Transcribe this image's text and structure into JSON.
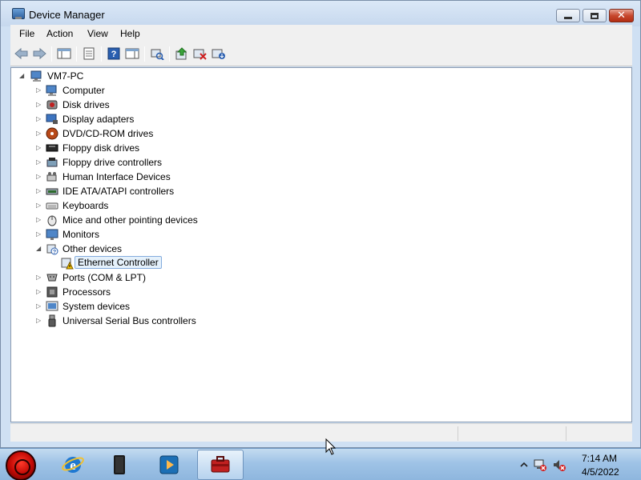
{
  "window": {
    "title": "Device Manager"
  },
  "menu": [
    "File",
    "Action",
    "View",
    "Help"
  ],
  "toolbar": {
    "buttons": [
      "back-arrow-icon",
      "forward-arrow-icon",
      "show-hide-console-tree-icon",
      "properties-icon",
      "help-icon",
      "action-pane-icon",
      "scan-hardware-icon",
      "update-driver-icon",
      "disable-icon",
      "uninstall-icon"
    ]
  },
  "tree": {
    "root": "VM7-PC",
    "categories": [
      {
        "label": "Computer",
        "icon": "computer-icon",
        "expanded": false
      },
      {
        "label": "Disk drives",
        "icon": "disk-drive-icon",
        "expanded": false
      },
      {
        "label": "Display adapters",
        "icon": "display-adapter-icon",
        "expanded": false
      },
      {
        "label": "DVD/CD-ROM drives",
        "icon": "dvd-drive-icon",
        "expanded": false
      },
      {
        "label": "Floppy disk drives",
        "icon": "floppy-disk-icon",
        "expanded": false
      },
      {
        "label": "Floppy drive controllers",
        "icon": "floppy-controller-icon",
        "expanded": false
      },
      {
        "label": "Human Interface Devices",
        "icon": "hid-icon",
        "expanded": false
      },
      {
        "label": "IDE ATA/ATAPI controllers",
        "icon": "ide-controller-icon",
        "expanded": false
      },
      {
        "label": "Keyboards",
        "icon": "keyboard-icon",
        "expanded": false
      },
      {
        "label": "Mice and other pointing devices",
        "icon": "mouse-icon",
        "expanded": false
      },
      {
        "label": "Monitors",
        "icon": "monitor-icon",
        "expanded": false
      },
      {
        "label": "Other devices",
        "icon": "unknown-device-icon",
        "expanded": true,
        "children": [
          {
            "label": "Ethernet Controller",
            "icon": "warning-device-icon",
            "selected": true
          }
        ]
      },
      {
        "label": "Ports (COM & LPT)",
        "icon": "port-icon",
        "expanded": false
      },
      {
        "label": "Processors",
        "icon": "processor-icon",
        "expanded": false
      },
      {
        "label": "System devices",
        "icon": "system-device-icon",
        "expanded": false
      },
      {
        "label": "Universal Serial Bus controllers",
        "icon": "usb-icon",
        "expanded": false
      }
    ]
  },
  "taskbar": {
    "apps": [
      "internet-explorer-icon",
      "windows-explorer-icon",
      "media-player-icon",
      "device-manager-icon"
    ],
    "active_app": "device-manager-icon",
    "clock_time": "7:14 AM",
    "clock_date": "4/5/2022"
  },
  "colors": {
    "selection_bg": "#e5f1fb",
    "selection_border": "#84acdd",
    "close_button": "#c7482f"
  }
}
